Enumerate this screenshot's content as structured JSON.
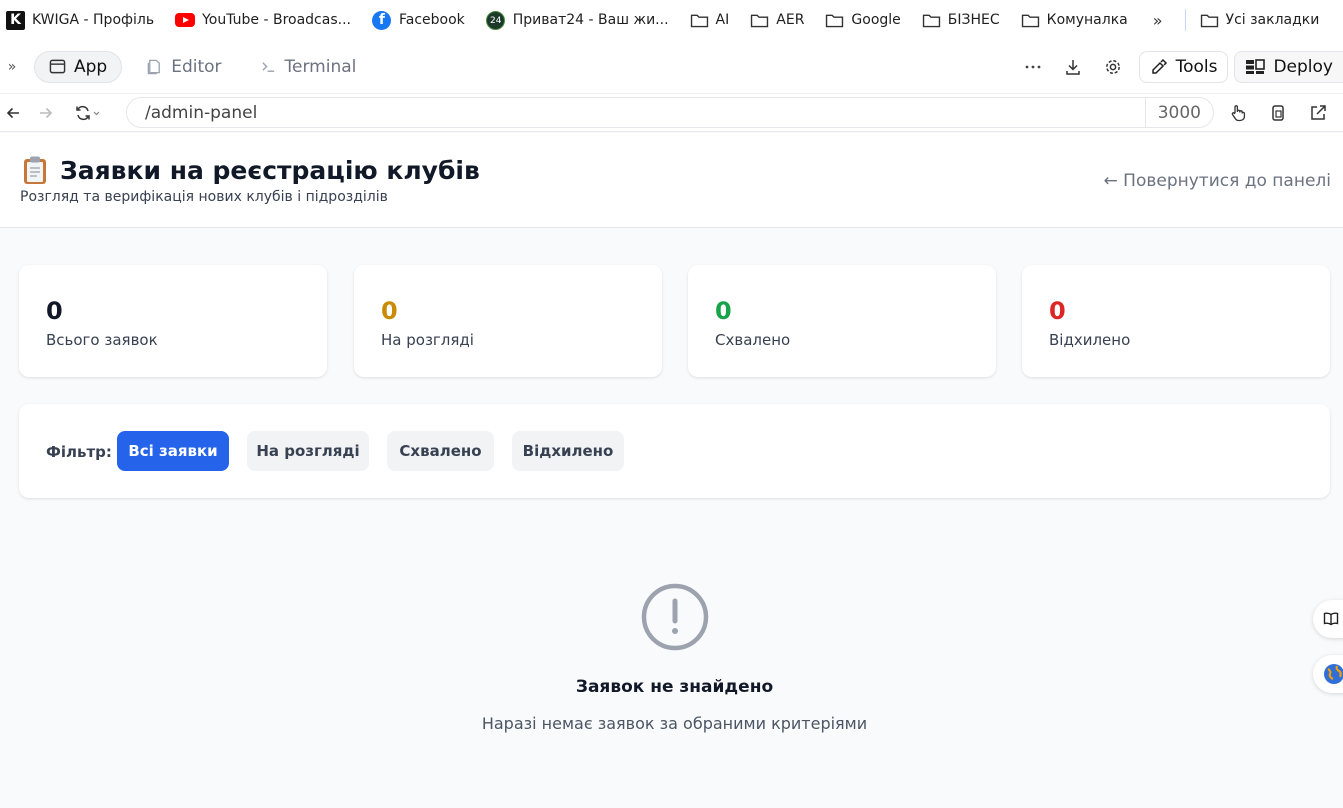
{
  "bookmarks": {
    "items": [
      {
        "label": "KWIGA - Профіль",
        "icon": "kwiga-logo-icon"
      },
      {
        "label": "YouTube - Broadcas...",
        "icon": "youtube-icon"
      },
      {
        "label": "Facebook",
        "icon": "facebook-icon"
      },
      {
        "label": "Приват24 - Ваш жи...",
        "icon": "privat24-icon"
      },
      {
        "label": "AI",
        "icon": "folder-icon"
      },
      {
        "label": "AER",
        "icon": "folder-icon"
      },
      {
        "label": "Google",
        "icon": "folder-icon"
      },
      {
        "label": "БІЗНЕС",
        "icon": "folder-icon"
      },
      {
        "label": "Комуналка",
        "icon": "folder-icon"
      }
    ],
    "more_label": "»",
    "all_bookmarks_label": "Усі закладки"
  },
  "toolbar": {
    "tabs": [
      {
        "label": "App",
        "icon": "browser-window-icon",
        "active": true
      },
      {
        "label": "Editor",
        "icon": "file-icon",
        "active": false
      },
      {
        "label": "Terminal",
        "icon": "terminal-icon",
        "active": false
      }
    ],
    "tools_label": "Tools",
    "deploy_label": "Deploy"
  },
  "urlbar": {
    "path": "/admin-panel",
    "port": "3000"
  },
  "page": {
    "title_icon": "📋",
    "title": "Заявки на реєстрацію клубів",
    "subtitle": "Розгляд та верифікація нових клубів і підрозділів",
    "back_link": "← Повернутися до панелі"
  },
  "stats": [
    {
      "value": "0",
      "label": "Всього заявок",
      "color": "#111827"
    },
    {
      "value": "0",
      "label": "На розгляді",
      "color": "#ca8a04"
    },
    {
      "value": "0",
      "label": "Схвалено",
      "color": "#16a34a"
    },
    {
      "value": "0",
      "label": "Відхилено",
      "color": "#dc2626"
    }
  ],
  "filter": {
    "label": "Фільтр:",
    "buttons": [
      {
        "label": "Всі заявки",
        "active": true
      },
      {
        "label": "На розгляді",
        "active": false
      },
      {
        "label": "Схвалено",
        "active": false
      },
      {
        "label": "Відхилено",
        "active": false
      }
    ]
  },
  "empty_state": {
    "icon": "alert-circle-icon",
    "title": "Заявок не знайдено",
    "text": "Наразі немає заявок за обраними критеріями"
  },
  "colors": {
    "accent": "#2563eb",
    "pending": "#ca8a04",
    "approved": "#16a34a",
    "rejected": "#dc2626"
  }
}
